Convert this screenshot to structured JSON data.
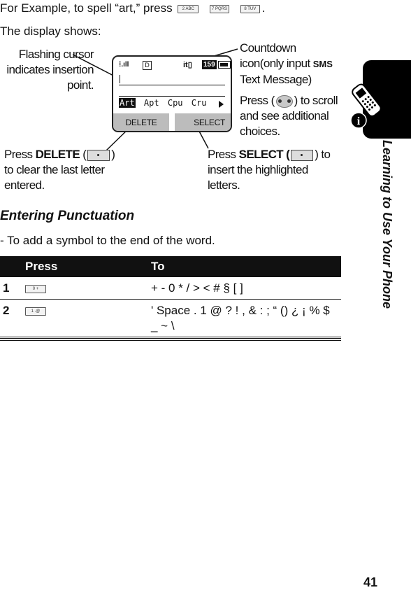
{
  "intro": {
    "line1_prefix": "For Example, to spell “art,” press",
    "keys": [
      "2 ABC",
      "7 PQRS",
      "8 TUV"
    ],
    "line1_suffix": ".",
    "line2": "The display shows:"
  },
  "display": {
    "status_d": "D",
    "status_it": "it",
    "countdown": "159",
    "choices": [
      "Art",
      "Apt",
      "Cpu",
      "Cru"
    ],
    "highlighted_choice": "Art",
    "soft_left": "DELETE",
    "soft_right": "SELECT"
  },
  "callouts": {
    "cursor": [
      "Flashing cursor",
      "indicates insertion",
      "point."
    ],
    "countdown_a": "Countdown",
    "countdown_b": "icon(only input",
    "countdown_sms": "SMS",
    "countdown_c": "Text Message)",
    "scroll_a": "Press (",
    "scroll_b": ") to scroll",
    "scroll_c": "and see additional",
    "scroll_d": "choices.",
    "delete_a": "Press",
    "delete_bold": "DELETE",
    "delete_b": "(",
    "delete_c": ")",
    "delete_d": "to clear the last letter",
    "delete_e": "entered.",
    "select_a": "Press",
    "select_bold": "SELECT (",
    "select_b": ") to",
    "select_c": "insert the highlighted",
    "select_d": "letters."
  },
  "section": {
    "heading": "Entering Punctuation",
    "description": "- To add a symbol to the end of the word."
  },
  "table": {
    "headers": [
      "Press",
      "To"
    ],
    "rows": [
      {
        "num": "1",
        "key": "0 +",
        "to": "+ - 0 * / > < # § [ ]"
      },
      {
        "num": "2",
        "key": "1 .@",
        "to": "' Space . 1 @ ? ! , & : ; “ () ¿ ¡ % $ _ ~ \\"
      }
    ]
  },
  "sidebar": {
    "title": "Learning to Use Your Phone"
  },
  "page_number": "41"
}
